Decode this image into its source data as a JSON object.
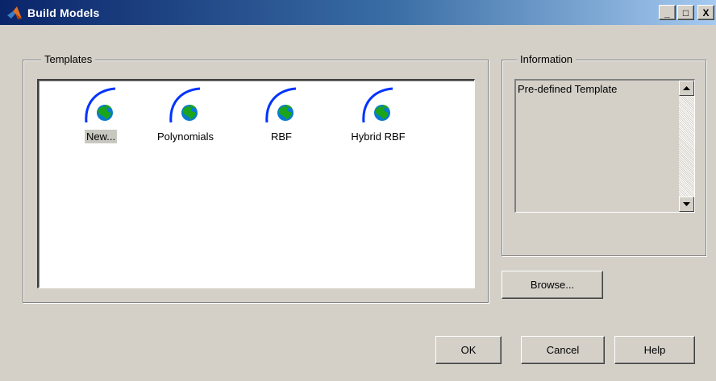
{
  "window": {
    "title": "Build Models",
    "controls": {
      "minimize": "_",
      "maximize": "□",
      "close": "X"
    }
  },
  "templates": {
    "label": "Templates",
    "items": [
      {
        "label": "New...",
        "icon": "model-template-icon",
        "selected": true
      },
      {
        "label": "Polynomials",
        "icon": "model-template-icon",
        "selected": false
      },
      {
        "label": "RBF",
        "icon": "model-template-icon",
        "selected": false
      },
      {
        "label": "Hybrid RBF",
        "icon": "model-template-icon",
        "selected": false
      }
    ]
  },
  "information": {
    "label": "Information",
    "text": "Pre-defined Template"
  },
  "buttons": {
    "browse": "Browse...",
    "ok": "OK",
    "cancel": "Cancel",
    "help": "Help"
  },
  "colors": {
    "titlebar_start": "#0a246a",
    "titlebar_end": "#a6caf0",
    "dialog_bg": "#d4d0c8",
    "icon_arc": "#0033ff",
    "icon_globe_water": "#0a7ad0",
    "icon_globe_land": "#1aa51a"
  }
}
